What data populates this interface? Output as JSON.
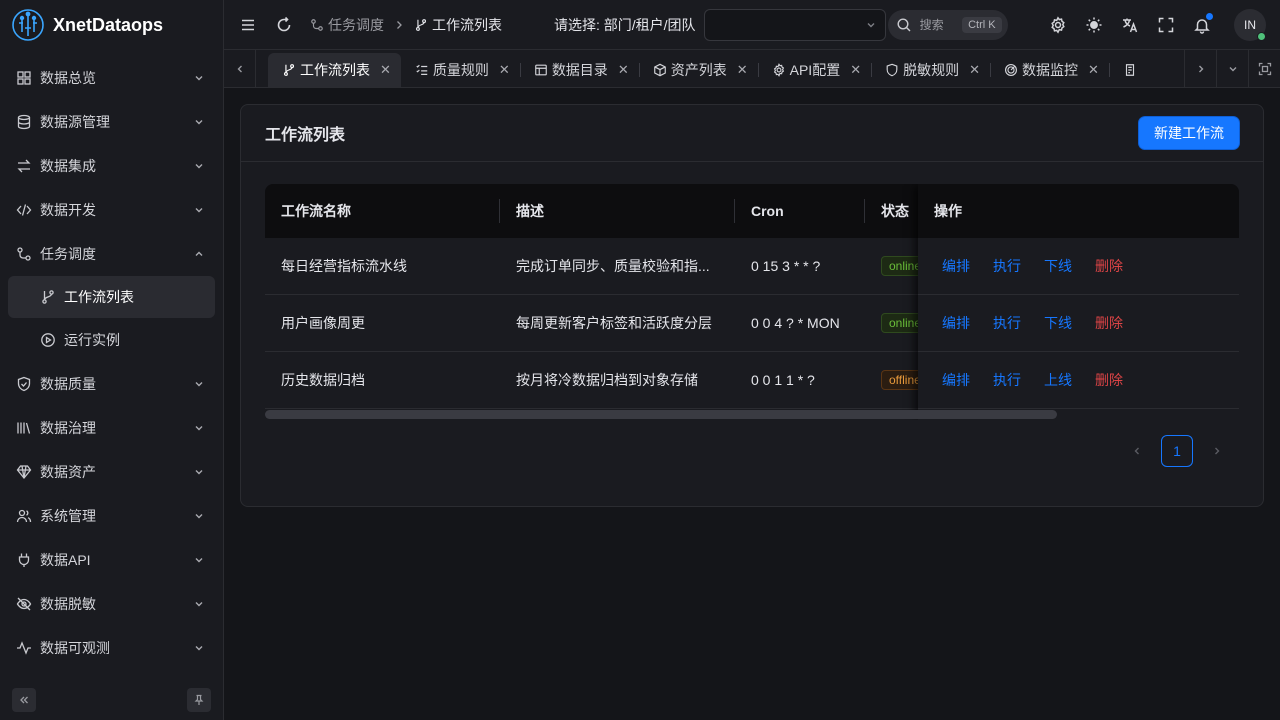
{
  "app": {
    "name": "XnetDataops"
  },
  "sidebar": {
    "items": [
      {
        "label": "数据总览",
        "icon": "dashboard-icon"
      },
      {
        "label": "数据源管理",
        "icon": "database-icon"
      },
      {
        "label": "数据集成",
        "icon": "swap-icon"
      },
      {
        "label": "数据开发",
        "icon": "code-icon"
      },
      {
        "label": "任务调度",
        "icon": "workflow-icon",
        "expanded": true,
        "children": [
          {
            "label": "工作流列表",
            "icon": "branch-icon",
            "active": true
          },
          {
            "label": "运行实例",
            "icon": "play-circle-icon"
          }
        ]
      },
      {
        "label": "数据质量",
        "icon": "shield-check-icon"
      },
      {
        "label": "数据治理",
        "icon": "library-icon"
      },
      {
        "label": "数据资产",
        "icon": "gem-icon"
      },
      {
        "label": "系统管理",
        "icon": "users-icon"
      },
      {
        "label": "数据API",
        "icon": "plug-icon"
      },
      {
        "label": "数据脱敏",
        "icon": "eye-off-icon"
      },
      {
        "label": "数据可观测",
        "icon": "activity-icon"
      }
    ]
  },
  "header": {
    "breadcrumb": [
      "任务调度",
      "工作流列表"
    ],
    "scope_label": "请选择: 部门/租户/团队",
    "search_placeholder": "搜索",
    "search_shortcut": "Ctrl K",
    "avatar_initials": "IN"
  },
  "tabs": [
    {
      "label": "工作流列表",
      "active": true
    },
    {
      "label": "质量规则"
    },
    {
      "label": "数据目录"
    },
    {
      "label": "资产列表"
    },
    {
      "label": "API配置"
    },
    {
      "label": "脱敏规则"
    },
    {
      "label": "数据监控"
    },
    {
      "label": ""
    }
  ],
  "page": {
    "title": "工作流列表",
    "new_button": "新建工作流",
    "columns": [
      "工作流名称",
      "描述",
      "Cron",
      "状态",
      "操作"
    ],
    "rows": [
      {
        "name": "每日经营指标流水线",
        "desc": "完成订单同步、质量校验和指...",
        "cron": "0 15 3 * * ?",
        "status": "online",
        "ops": [
          "编排",
          "执行",
          "下线",
          "删除"
        ]
      },
      {
        "name": "用户画像周更",
        "desc": "每周更新客户标签和活跃度分层",
        "cron": "0 0 4 ? * MON",
        "status": "online",
        "ops": [
          "编排",
          "执行",
          "下线",
          "删除"
        ]
      },
      {
        "name": "历史数据归档",
        "desc": "按月将冷数据归档到对象存储",
        "cron": "0 0 1 1 * ?",
        "status": "offline",
        "ops": [
          "编排",
          "执行",
          "上线",
          "删除"
        ]
      }
    ],
    "pagination": {
      "current": "1"
    }
  },
  "colors": {
    "primary": "#1677ff",
    "danger": "#dc4446",
    "online": "#6abe39",
    "offline": "#e89a3c"
  }
}
